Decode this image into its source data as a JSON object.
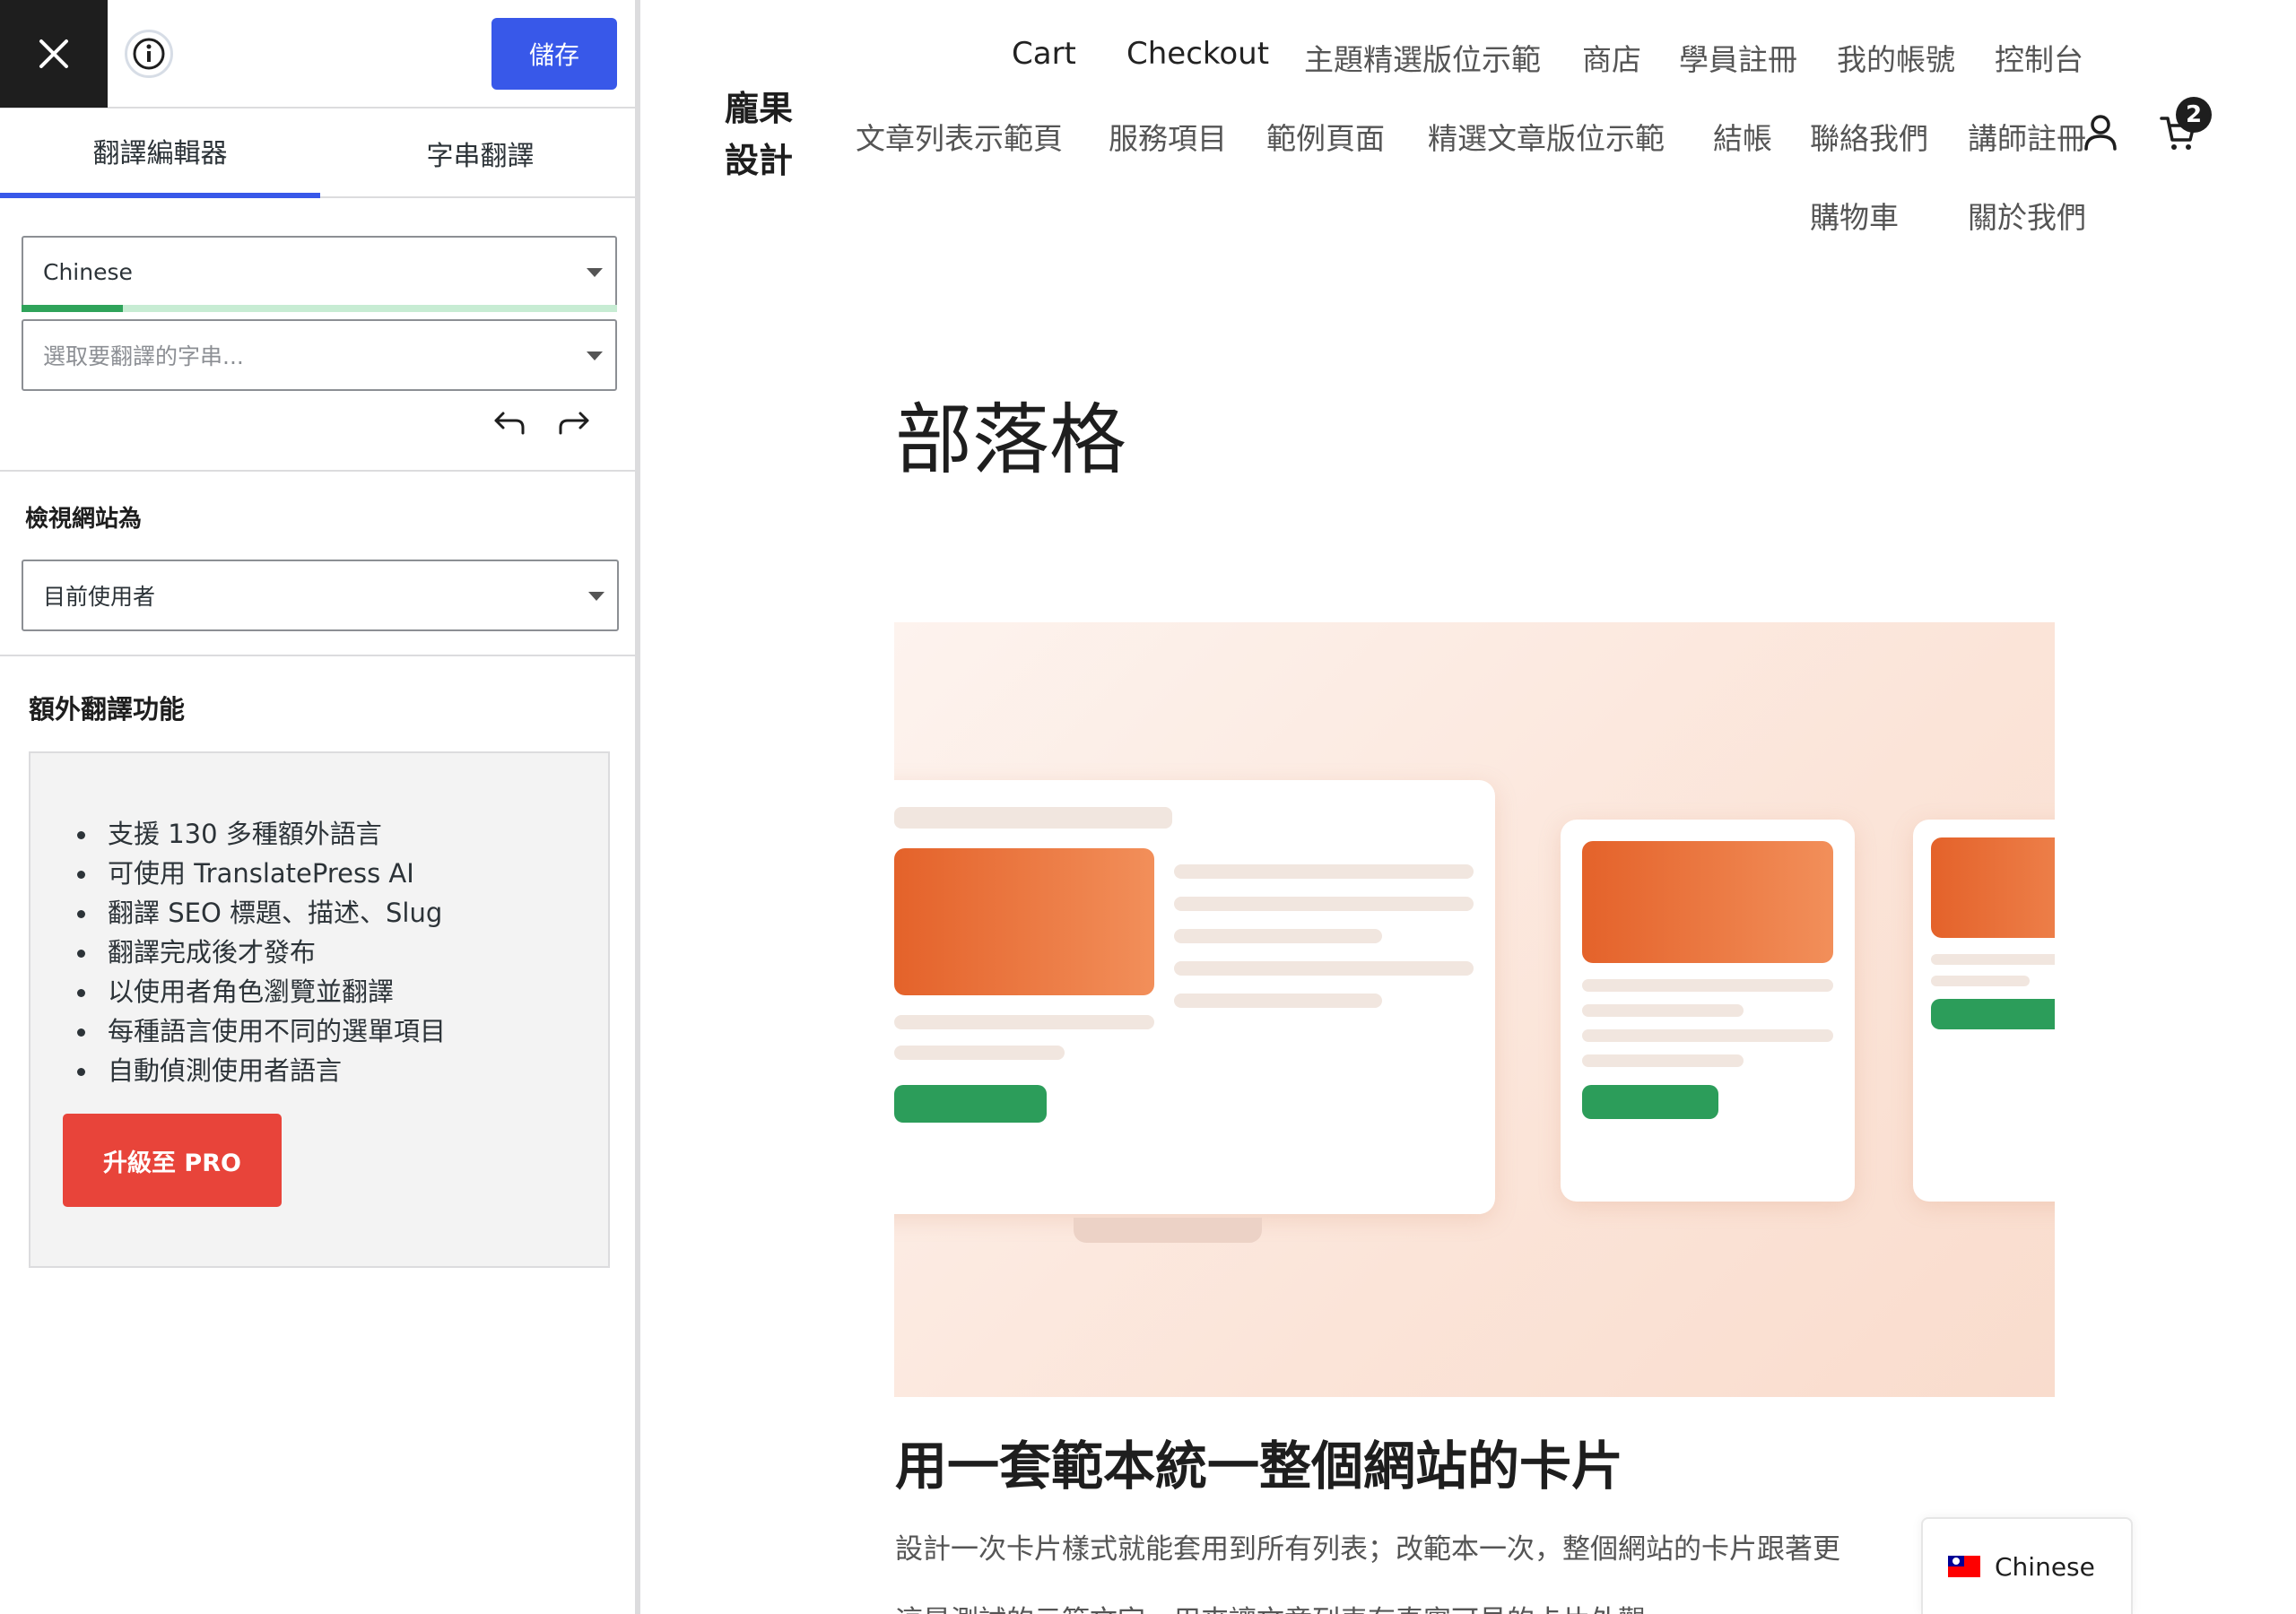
{
  "editor": {
    "save_label": "儲存",
    "tabs": [
      {
        "label": "翻譯編輯器",
        "active": true
      },
      {
        "label": "字串翻譯",
        "active": false
      }
    ],
    "language_select": {
      "value": "Chinese"
    },
    "translation_progress": 0.17,
    "string_select": {
      "placeholder": "選取要翻譯的字串..."
    },
    "view_as": {
      "heading": "檢視網站為",
      "value": "目前使用者"
    },
    "extra": {
      "heading": "額外翻譯功能",
      "features": [
        "支援 130 多種額外語言",
        "可使用 TranslatePress AI",
        "翻譯 SEO 標題、描述、Slug",
        "翻譯完成後才發布",
        "以使用者角色瀏覽並翻譯",
        "每種語言使用不同的選單項目",
        "自動偵測使用者語言"
      ],
      "upgrade_label": "升級至 PRO"
    },
    "colors": {
      "accent": "#3858e9",
      "upgrade": "#e8443a",
      "progress": "#2fa35a"
    }
  },
  "site": {
    "logo": "龐果設計",
    "nav_row1": [
      "Cart",
      "Checkout",
      "主題精選版位示範",
      "商店",
      "學員註冊",
      "我的帳號",
      "控制台"
    ],
    "nav_row2": [
      "文章列表示範頁",
      "服務項目",
      "範例頁面",
      "精選文章版位示範",
      "結帳",
      "聯絡我們",
      "講師註冊"
    ],
    "nav_row3": [
      "購物車",
      "關於我們"
    ],
    "cart_count": "2",
    "page_title": "部落格",
    "post": {
      "title": "用一套範本統一整個網站的卡片",
      "excerpt": "設計一次卡片樣式就能套用到所有列表；改範本一次，整個網站的卡片跟著更",
      "excerpt2": "這是測試的示範文字，用來讓文章列表有真實可見的卡片外觀"
    },
    "language_switcher": {
      "label": "Chinese"
    }
  }
}
